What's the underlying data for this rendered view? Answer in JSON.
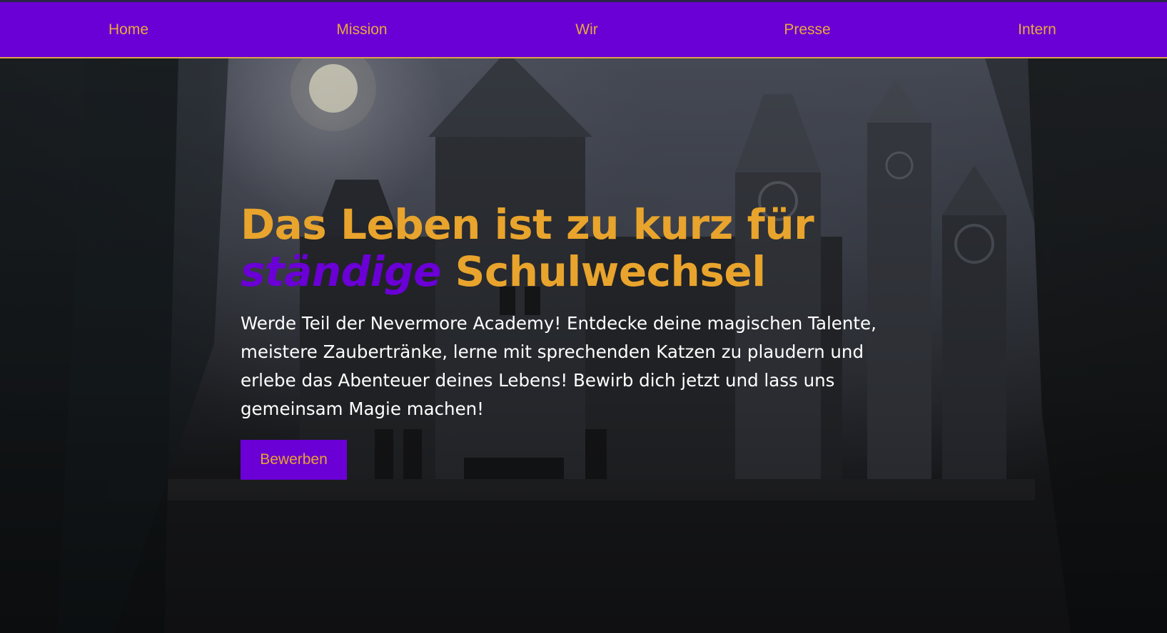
{
  "nav": {
    "items": [
      {
        "label": "Home"
      },
      {
        "label": "Mission"
      },
      {
        "label": "Wir"
      },
      {
        "label": "Presse"
      },
      {
        "label": "Intern"
      }
    ]
  },
  "hero": {
    "headline_part1": "Das Leben ist zu kurz für",
    "headline_accent": "ständige",
    "headline_part2": " Schulwechsel",
    "lead": "Werde Teil der Nevermore Academy! Entdecke deine magischen Talente, meistere Zaubertränke, lerne mit sprechenden Katzen zu plaudern und erlebe das Abenteuer deines Lebens! Bewirb dich jetzt und lass uns gemeinsam Magie machen!",
    "cta_label": "Bewerben"
  },
  "colors": {
    "brand_purple": "#6a00d6",
    "accent_gold": "#e8a42c"
  }
}
